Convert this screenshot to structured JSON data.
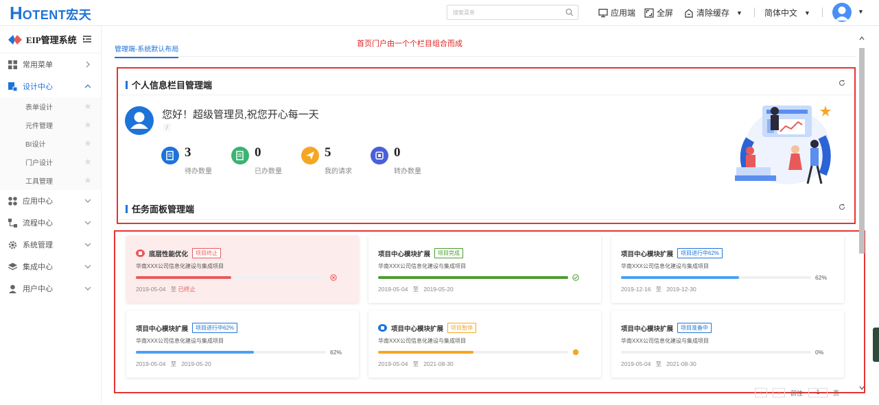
{
  "header": {
    "logo_h": "H",
    "logo_rest": "OTENT宏天",
    "search_placeholder": "搜索菜单",
    "app_label": "应用端",
    "fullscreen_label": "全屏",
    "clear_cache_label": "清除缓存",
    "language_label": "简体中文"
  },
  "sidebar": {
    "title": "EIP管理系统",
    "items": [
      {
        "label": "常用菜单"
      },
      {
        "label": "设计中心"
      },
      {
        "label": "应用中心"
      },
      {
        "label": "流程中心"
      },
      {
        "label": "系统管理"
      },
      {
        "label": "集成中心"
      },
      {
        "label": "用户中心"
      }
    ],
    "sub_items": [
      {
        "label": "表单设计"
      },
      {
        "label": "元件管理"
      },
      {
        "label": "BI设计"
      },
      {
        "label": "门户设计"
      },
      {
        "label": "工具管理"
      }
    ]
  },
  "main": {
    "tab_label": "管理端-系统默认布局",
    "annotation": "首页门户由一个个栏目组合而成",
    "panel1_title": "个人信息栏目管理端",
    "panel2_title": "任务面板管理端",
    "greeting": "您好！超级管理员,祝您开心每一天",
    "greeting_sub": "/",
    "stats": [
      {
        "value": "3",
        "label": "待办数量",
        "color": "#1e73d8"
      },
      {
        "value": "0",
        "label": "已办数量",
        "color": "#3cb371"
      },
      {
        "value": "5",
        "label": "我的请求",
        "color": "#f5a623"
      },
      {
        "value": "0",
        "label": "转办数量",
        "color": "#4a5fd9"
      }
    ],
    "cards": [
      {
        "title": "底层性能优化",
        "tag": "项目终止",
        "desc": "华南XXX公司信息化建设与集成项目",
        "progress": 0.5,
        "pct": "",
        "start": "2019-05-04",
        "to": "至",
        "end": "已终止",
        "color": "#e85a5a"
      },
      {
        "title": "项目中心模块扩展",
        "tag": "项目完成",
        "desc": "华南XXX公司信息化建设与集成项目",
        "progress": 1.0,
        "pct": "",
        "start": "2019-05-04",
        "to": "至",
        "end": "2019-05-20",
        "color": "#4a9d2e"
      },
      {
        "title": "项目中心模块扩展",
        "tag": "项目进行中62%",
        "desc": "华南XXX公司信息化建设与集成项目",
        "progress": 0.62,
        "pct": "62%",
        "start": "2019-12-16",
        "to": "至",
        "end": "2019-12-30",
        "color": "#4a9ff5"
      },
      {
        "title": "项目中心模块扩展",
        "tag": "项目进行中62%",
        "desc": "华南XXX公司信息化建设与集成项目",
        "progress": 0.62,
        "pct": "62%",
        "start": "2019-05-04",
        "to": "至",
        "end": "2019-05-20",
        "color": "#4a9ff5"
      },
      {
        "title": "项目中心模块扩展",
        "tag": "项目暂停",
        "desc": "华南XXX公司信息化建设与集成项目",
        "progress": 0.5,
        "pct": "",
        "start": "2019-05-04",
        "to": "至",
        "end": "2021-08-30",
        "color": "#f5a623"
      },
      {
        "title": "项目中心模块扩展",
        "tag": "项目准备中",
        "desc": "华南XXX公司信息化建设与集成项目",
        "progress": 0.0,
        "pct": "0%",
        "start": "2019-05-04",
        "to": "至",
        "end": "2021-08-30",
        "color": "#1e73d8"
      }
    ],
    "pager": {
      "goto_label": "前往",
      "page": "1",
      "page_unit": "页"
    }
  }
}
